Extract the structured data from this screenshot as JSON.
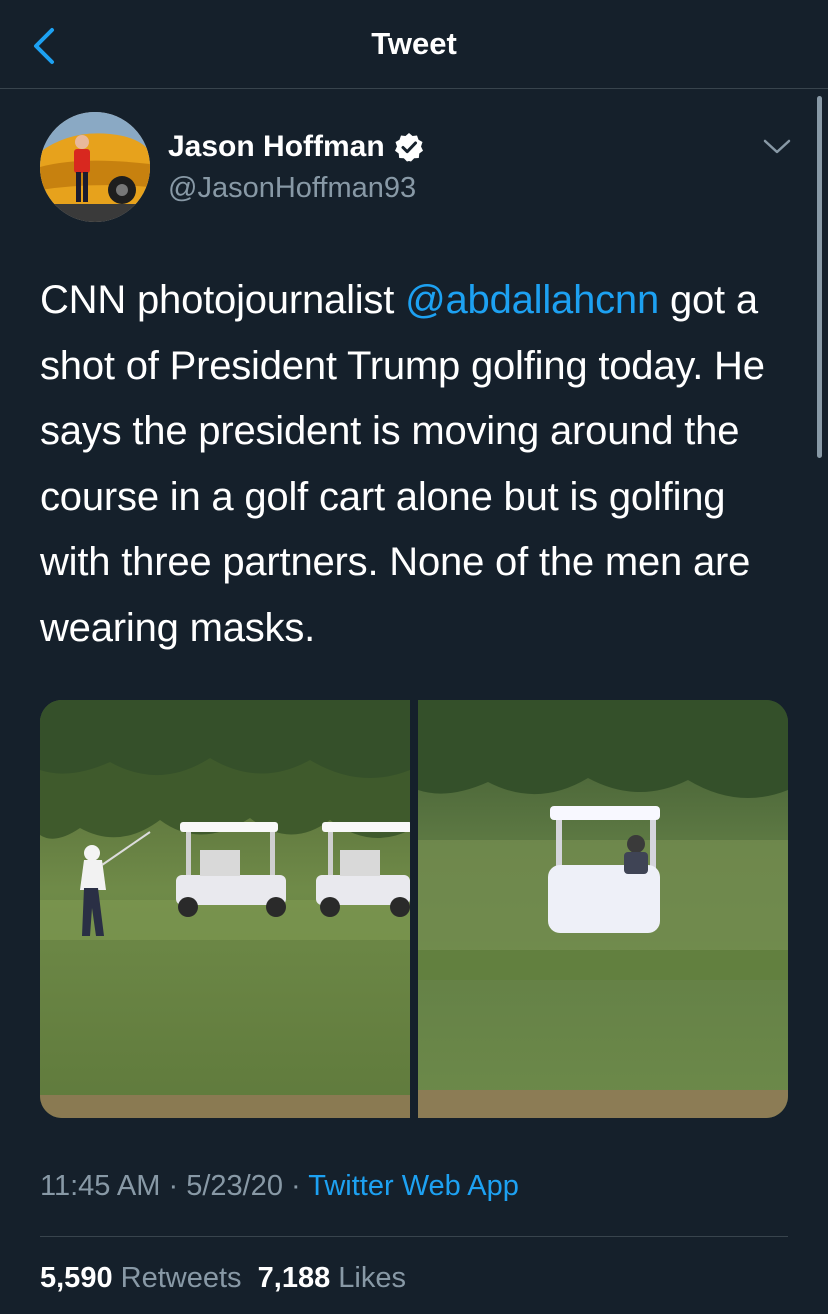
{
  "header": {
    "title": "Tweet",
    "back_icon": "chevron-left-icon"
  },
  "author": {
    "name": "Jason Hoffman",
    "handle": "@JasonHoffman93",
    "verified": true
  },
  "tweet": {
    "text_before": "CNN photojournalist ",
    "mention": "@abdallahcnn",
    "text_after": " got a shot of President Trump golfing today. He says the president is moving around the course in a golf cart alone but is golfing with three partners. None of the men are wearing masks."
  },
  "meta": {
    "time": "11:45 AM",
    "separator": "·",
    "date": "5/23/20",
    "app": "Twitter Web App"
  },
  "stats": {
    "retweets_count": "5,590",
    "retweets_label": "Retweets",
    "likes_count": "7,188",
    "likes_label": "Likes"
  },
  "colors": {
    "background": "#15202b",
    "accent": "#1da1f2",
    "secondary_text": "#8899a6",
    "divider": "#38444d"
  }
}
